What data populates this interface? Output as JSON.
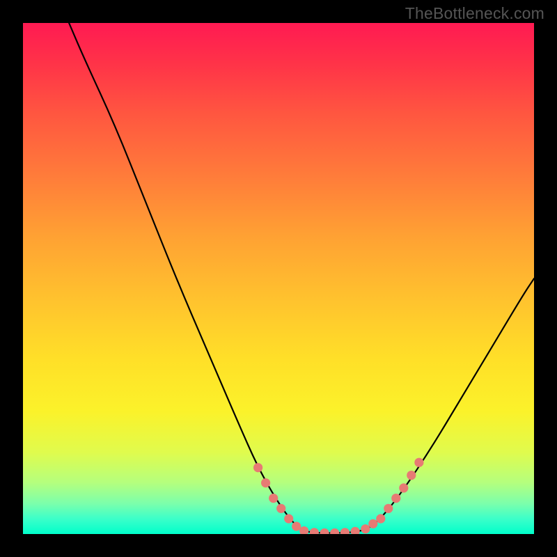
{
  "watermark": "TheBottleneck.com",
  "colors": {
    "background": "#000000",
    "gradient_top": "#ff1a52",
    "gradient_bottom": "#00ffcb",
    "curve": "#000000",
    "dot": "#e77a74"
  },
  "chart_data": {
    "type": "line",
    "title": "",
    "xlabel": "",
    "ylabel": "",
    "xlim": [
      0,
      100
    ],
    "ylim": [
      0,
      100
    ],
    "grid": false,
    "description": "Bottleneck curve: a steep descending branch from top-left, a flat valley near the bottom around x≈55–67, and a rising branch toward mid-right. Pink dots highlight points near the valley.",
    "curve": [
      {
        "x": 9.0,
        "y": 100.0
      },
      {
        "x": 12.0,
        "y": 93.0
      },
      {
        "x": 18.0,
        "y": 80.0
      },
      {
        "x": 24.0,
        "y": 65.0
      },
      {
        "x": 30.0,
        "y": 50.0
      },
      {
        "x": 36.0,
        "y": 36.0
      },
      {
        "x": 42.0,
        "y": 22.0
      },
      {
        "x": 46.0,
        "y": 13.0
      },
      {
        "x": 50.0,
        "y": 6.0
      },
      {
        "x": 53.0,
        "y": 2.0
      },
      {
        "x": 55.0,
        "y": 0.5
      },
      {
        "x": 58.0,
        "y": 0.2
      },
      {
        "x": 62.0,
        "y": 0.2
      },
      {
        "x": 65.0,
        "y": 0.4
      },
      {
        "x": 67.5,
        "y": 1.0
      },
      {
        "x": 70.0,
        "y": 3.0
      },
      {
        "x": 74.0,
        "y": 8.0
      },
      {
        "x": 80.0,
        "y": 17.0
      },
      {
        "x": 86.0,
        "y": 27.0
      },
      {
        "x": 92.0,
        "y": 37.0
      },
      {
        "x": 98.0,
        "y": 47.0
      },
      {
        "x": 100.0,
        "y": 50.0
      }
    ],
    "valley_dots": [
      {
        "x": 46.0,
        "y": 13.0
      },
      {
        "x": 47.5,
        "y": 10.0
      },
      {
        "x": 49.0,
        "y": 7.0
      },
      {
        "x": 50.5,
        "y": 5.0
      },
      {
        "x": 52.0,
        "y": 3.0
      },
      {
        "x": 53.5,
        "y": 1.5
      },
      {
        "x": 55.0,
        "y": 0.6
      },
      {
        "x": 57.0,
        "y": 0.3
      },
      {
        "x": 59.0,
        "y": 0.2
      },
      {
        "x": 61.0,
        "y": 0.2
      },
      {
        "x": 63.0,
        "y": 0.3
      },
      {
        "x": 65.0,
        "y": 0.5
      },
      {
        "x": 67.0,
        "y": 1.0
      },
      {
        "x": 68.5,
        "y": 2.0
      },
      {
        "x": 70.0,
        "y": 3.0
      },
      {
        "x": 71.5,
        "y": 5.0
      },
      {
        "x": 73.0,
        "y": 7.0
      },
      {
        "x": 74.5,
        "y": 9.0
      },
      {
        "x": 76.0,
        "y": 11.5
      },
      {
        "x": 77.5,
        "y": 14.0
      }
    ],
    "dot_radius_pct": 0.9
  }
}
